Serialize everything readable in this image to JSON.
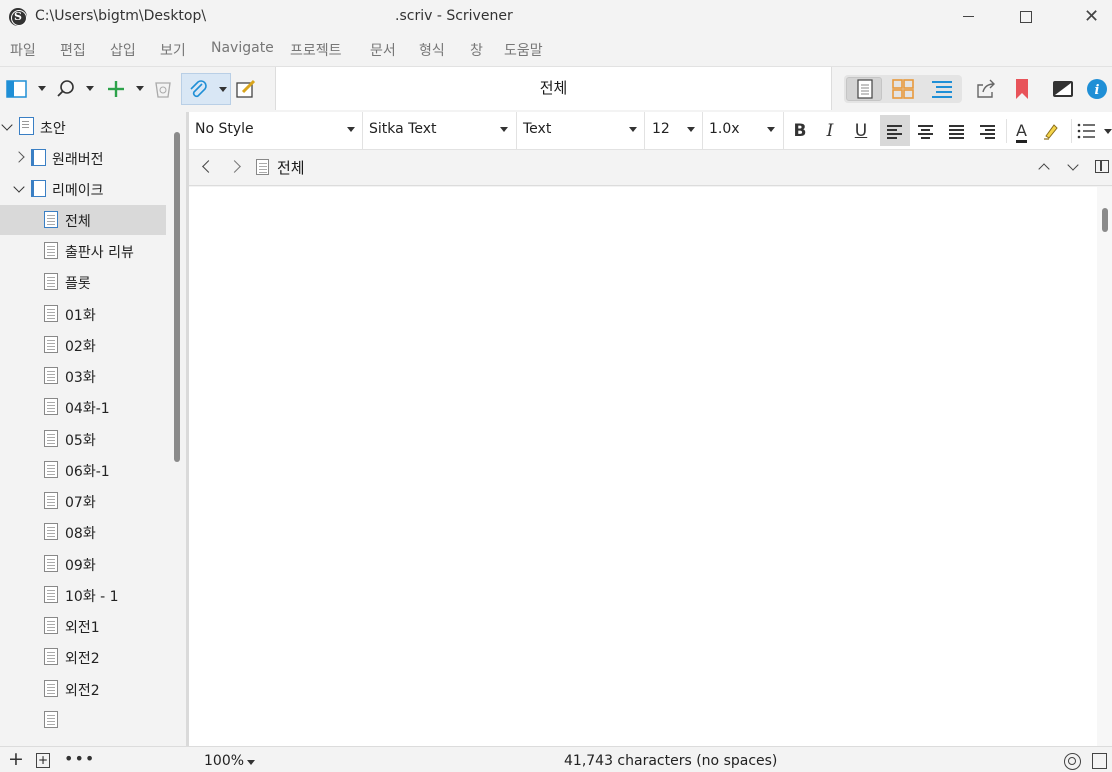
{
  "window": {
    "path": "C:\\Users\\bigtm\\Desktop\\",
    "app_title": ".scriv - Scrivener"
  },
  "menu": [
    "파일",
    "편집",
    "삽입",
    "보기",
    "Navigate",
    "프로젝트",
    "문서",
    "형식",
    "창",
    "도움말"
  ],
  "toolbar": {
    "document_title": "전체"
  },
  "binder": {
    "items": [
      {
        "label": "초안",
        "level": 0,
        "icon": "draft-icon",
        "expander": "down"
      },
      {
        "label": "원래버전",
        "level": 1,
        "icon": "folder-icon",
        "expander": "right"
      },
      {
        "label": "리메이크",
        "level": 1,
        "icon": "folder-icon",
        "expander": "down"
      },
      {
        "label": "전체",
        "level": 2,
        "icon": "document-icon",
        "selected": true
      },
      {
        "label": "출판사 리뷰",
        "level": 2,
        "icon": "document-icon"
      },
      {
        "label": "플롯",
        "level": 2,
        "icon": "document-icon"
      },
      {
        "label": "01화",
        "level": 2,
        "icon": "document-icon"
      },
      {
        "label": "02화",
        "level": 2,
        "icon": "document-icon"
      },
      {
        "label": "03화",
        "level": 2,
        "icon": "document-icon"
      },
      {
        "label": "04화-1",
        "level": 2,
        "icon": "document-icon"
      },
      {
        "label": "05화",
        "level": 2,
        "icon": "document-icon"
      },
      {
        "label": "06화-1",
        "level": 2,
        "icon": "document-icon"
      },
      {
        "label": "07화",
        "level": 2,
        "icon": "document-icon"
      },
      {
        "label": "08화",
        "level": 2,
        "icon": "document-icon"
      },
      {
        "label": "09화",
        "level": 2,
        "icon": "document-icon"
      },
      {
        "label": "10화 - 1",
        "level": 2,
        "icon": "document-icon"
      },
      {
        "label": "외전1",
        "level": 2,
        "icon": "document-icon"
      },
      {
        "label": "외전2",
        "level": 2,
        "icon": "document-icon"
      },
      {
        "label": "외전2",
        "level": 2,
        "icon": "document-icon"
      },
      {
        "label": "",
        "level": 2,
        "icon": "document-icon"
      }
    ]
  },
  "format_bar": {
    "style": "No Style",
    "font": "Sitka Text",
    "typeface": "Text",
    "size": "12",
    "line_spacing": "1.0x",
    "bold": "B",
    "italic": "I",
    "underline": "U",
    "text_color_glyph": "A"
  },
  "header_bar": {
    "title": "전체"
  },
  "footer": {
    "zoom": "100%",
    "word_count": "41,743 characters (no spaces)"
  },
  "colors": {
    "accent_blue": "#1f8fd6",
    "add_green": "#2ca24a",
    "bookmark_red": "#e8535a",
    "corkboard_orange": "#e89a3c"
  }
}
